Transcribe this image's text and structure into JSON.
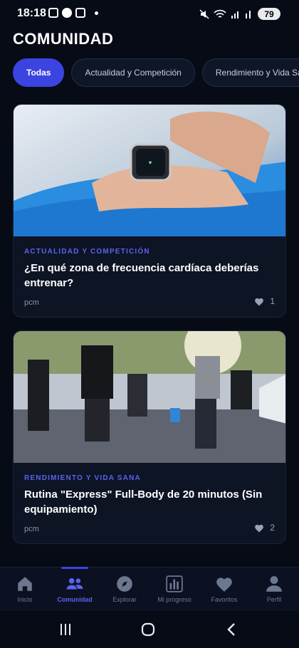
{
  "status_bar": {
    "time": "18:18",
    "battery": "79"
  },
  "header": {
    "title": "COMUNIDAD"
  },
  "filters": [
    {
      "label": "Todas",
      "active": true
    },
    {
      "label": "Actualidad y Competición",
      "active": false
    },
    {
      "label": "Rendimiento y Vida Sana",
      "active": false
    }
  ],
  "posts": [
    {
      "category": "ACTUALIDAD Y COMPETICIÓN",
      "title": "¿En qué zona de frecuencia cardíaca deberías entrenar?",
      "author": "pcm",
      "likes": "1",
      "image": "smartwatch-photo"
    },
    {
      "category": "RENDIMIENTO Y VIDA SANA",
      "title": "Rutina \"Express\" Full-Body de 20 minutos (Sin equipamiento)",
      "author": "pcm",
      "likes": "2",
      "image": "group-workout-photo"
    }
  ],
  "bottom_nav": [
    {
      "label": "Inicio",
      "icon": "home-icon",
      "active": false
    },
    {
      "label": "Comunidad",
      "icon": "people-icon",
      "active": true
    },
    {
      "label": "Explorar",
      "icon": "compass-icon",
      "active": false
    },
    {
      "label": "Mi progreso",
      "icon": "bar-chart-icon",
      "active": false
    },
    {
      "label": "Favoritos",
      "icon": "heart-icon",
      "active": false
    },
    {
      "label": "Perfil",
      "icon": "user-icon",
      "active": false
    }
  ],
  "colors": {
    "background": "#070b16",
    "accent": "#3b44e0",
    "category": "#5a63f0",
    "card": "#0d1424"
  }
}
